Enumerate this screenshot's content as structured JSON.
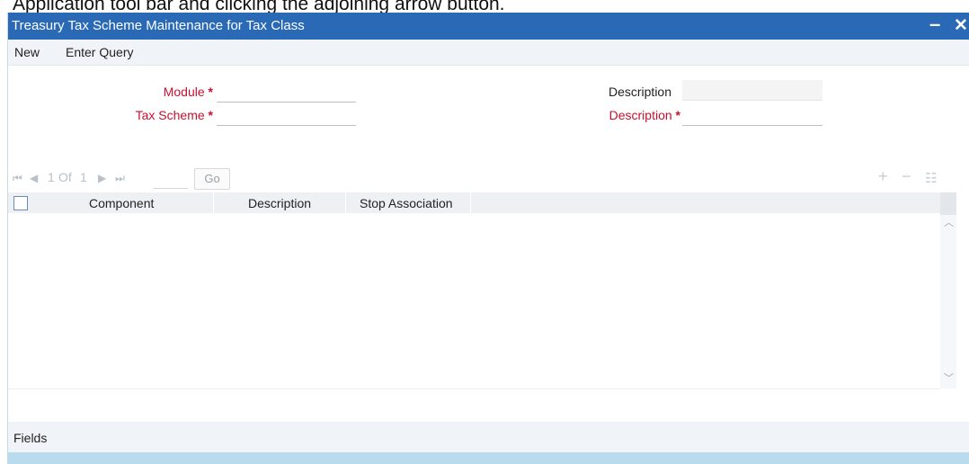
{
  "doc_text": "Application tool bar and clicking the adjoining arrow button.",
  "window": {
    "title": "Treasury Tax Scheme Maintenance for Tax Class",
    "minimize_glyph": "–",
    "close_glyph": "✕"
  },
  "menu": {
    "new_label": "New",
    "enter_query_label": "Enter Query"
  },
  "form": {
    "module_label": "Module",
    "module_value": "",
    "tax_scheme_label": "Tax Scheme",
    "tax_scheme_value": "",
    "description_label": "Description",
    "description_value": "",
    "description_required_label": "Description",
    "description_required_value": "",
    "required_marker": "*"
  },
  "pager": {
    "first_glyph": "⏮",
    "prev_glyph": "◀",
    "current": "1",
    "of_label": "Of",
    "total": "1",
    "next_glyph": "▶",
    "last_glyph": "⏭",
    "go_label": "Go"
  },
  "grid_tools": {
    "add": "+",
    "remove": "−",
    "view": "☷"
  },
  "grid": {
    "columns": [
      "Component",
      "Description",
      "Stop Association"
    ]
  },
  "footer": {
    "fields_label": "Fields"
  },
  "colors": {
    "titlebar": "#2a69b5",
    "required": "#c8102e",
    "bottom_strip": "#b9dbee"
  }
}
